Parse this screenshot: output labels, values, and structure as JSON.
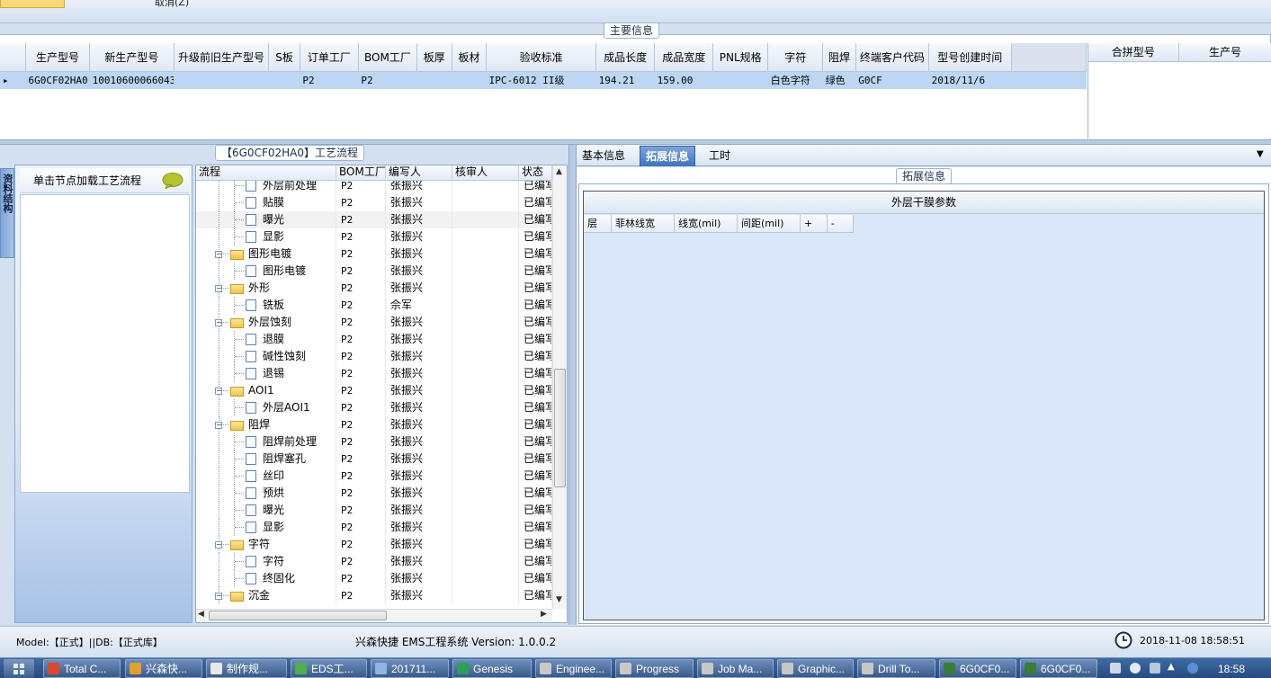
{
  "top": {
    "cancel_label": "取消(Z)"
  },
  "main_info": {
    "title": "主要信息",
    "columns": [
      "",
      "生产型号",
      "新生产型号",
      "升级前旧生产型号",
      "S板",
      "订单工厂",
      "BOM工厂",
      "板厚",
      "板材",
      "验收标准",
      "成品长度",
      "成品宽度",
      "PNL规格",
      "字符",
      "阻焊",
      "终端客户代码",
      "型号创建时间",
      ""
    ],
    "rows": [
      [
        "▸",
        "6G0CF02HA0",
        "10010600066043",
        "",
        "",
        "P2",
        "P2",
        "",
        "",
        "IPC-6012 II级",
        "194.21",
        "159.00",
        "",
        "白色字符",
        "绿色",
        "G0CF",
        "2018/11/6",
        ""
      ]
    ],
    "merge_columns": [
      "合拼型号",
      "生产号"
    ]
  },
  "left_panel": {
    "vertical_tab": "资料结构",
    "card_text": "单击节点加载工艺流程"
  },
  "flow": {
    "title": "【6G0CF02HA0】工艺流程",
    "columns": [
      "流程",
      "BOM工厂",
      "编写人",
      "核审人",
      "状态"
    ],
    "rows": [
      {
        "name": "外层前处理",
        "level": 2,
        "type": "doc",
        "bom": "P2",
        "writer": "张振兴",
        "reviewer": "",
        "status": "已编写"
      },
      {
        "name": "贴膜",
        "level": 2,
        "type": "doc",
        "bom": "P2",
        "writer": "张振兴",
        "reviewer": "",
        "status": "已编写"
      },
      {
        "name": "曝光",
        "level": 2,
        "type": "doc",
        "bom": "P2",
        "writer": "张振兴",
        "reviewer": "",
        "status": "已编写",
        "highlight": true
      },
      {
        "name": "显影",
        "level": 2,
        "type": "doc",
        "bom": "P2",
        "writer": "张振兴",
        "reviewer": "",
        "status": "已编写"
      },
      {
        "name": "图形电镀",
        "level": 1,
        "type": "folder",
        "bom": "P2",
        "writer": "张振兴",
        "reviewer": "",
        "status": "已编写"
      },
      {
        "name": "图形电镀",
        "level": 2,
        "type": "doc",
        "bom": "P2",
        "writer": "张振兴",
        "reviewer": "",
        "status": "已编写"
      },
      {
        "name": "外形",
        "level": 1,
        "type": "folder",
        "bom": "P2",
        "writer": "张振兴",
        "reviewer": "",
        "status": "已编写"
      },
      {
        "name": "铣板",
        "level": 2,
        "type": "doc",
        "bom": "P2",
        "writer": "佘军",
        "reviewer": "",
        "status": "已编写"
      },
      {
        "name": "外层蚀刻",
        "level": 1,
        "type": "folder",
        "bom": "P2",
        "writer": "张振兴",
        "reviewer": "",
        "status": "已编写"
      },
      {
        "name": "退膜",
        "level": 2,
        "type": "doc",
        "bom": "P2",
        "writer": "张振兴",
        "reviewer": "",
        "status": "已编写"
      },
      {
        "name": "碱性蚀刻",
        "level": 2,
        "type": "doc",
        "bom": "P2",
        "writer": "张振兴",
        "reviewer": "",
        "status": "已编写"
      },
      {
        "name": "退锡",
        "level": 2,
        "type": "doc",
        "bom": "P2",
        "writer": "张振兴",
        "reviewer": "",
        "status": "已编写"
      },
      {
        "name": "AOI1",
        "level": 1,
        "type": "folder",
        "bom": "P2",
        "writer": "张振兴",
        "reviewer": "",
        "status": "已编写"
      },
      {
        "name": "外层AOI1",
        "level": 2,
        "type": "doc",
        "bom": "P2",
        "writer": "张振兴",
        "reviewer": "",
        "status": "已编写"
      },
      {
        "name": "阻焊",
        "level": 1,
        "type": "folder",
        "bom": "P2",
        "writer": "张振兴",
        "reviewer": "",
        "status": "已编写"
      },
      {
        "name": "阻焊前处理",
        "level": 2,
        "type": "doc",
        "bom": "P2",
        "writer": "张振兴",
        "reviewer": "",
        "status": "已编写"
      },
      {
        "name": "阻焊塞孔",
        "level": 2,
        "type": "doc",
        "bom": "P2",
        "writer": "张振兴",
        "reviewer": "",
        "status": "已编写"
      },
      {
        "name": "丝印",
        "level": 2,
        "type": "doc",
        "bom": "P2",
        "writer": "张振兴",
        "reviewer": "",
        "status": "已编写"
      },
      {
        "name": "预烘",
        "level": 2,
        "type": "doc",
        "bom": "P2",
        "writer": "张振兴",
        "reviewer": "",
        "status": "已编写"
      },
      {
        "name": "曝光",
        "level": 2,
        "type": "doc",
        "bom": "P2",
        "writer": "张振兴",
        "reviewer": "",
        "status": "已编写"
      },
      {
        "name": "显影",
        "level": 2,
        "type": "doc",
        "bom": "P2",
        "writer": "张振兴",
        "reviewer": "",
        "status": "已编写"
      },
      {
        "name": "字符",
        "level": 1,
        "type": "folder",
        "bom": "P2",
        "writer": "张振兴",
        "reviewer": "",
        "status": "已编写"
      },
      {
        "name": "字符",
        "level": 2,
        "type": "doc",
        "bom": "P2",
        "writer": "张振兴",
        "reviewer": "",
        "status": "已编写"
      },
      {
        "name": "终固化",
        "level": 2,
        "type": "doc",
        "bom": "P2",
        "writer": "张振兴",
        "reviewer": "",
        "status": "已编写"
      },
      {
        "name": "沉金",
        "level": 1,
        "type": "folder",
        "bom": "P2",
        "writer": "张振兴",
        "reviewer": "",
        "status": "已编写"
      }
    ]
  },
  "right_panel": {
    "tabs": [
      {
        "label": "基本信息",
        "active": false
      },
      {
        "label": "拓展信息",
        "active": true
      },
      {
        "label": "工时",
        "active": false
      }
    ],
    "ext_title": "拓展信息",
    "dry_film_title": "外层干膜参数",
    "dry_film_columns": [
      "层",
      "菲林线宽",
      "线宽(mil)",
      "间距(mil)",
      "+",
      "-"
    ]
  },
  "status_bar": {
    "left": "Model:【正式】||DB:【正式库】",
    "center": "兴森快捷 EMS工程系统 Version: 1.0.0.2",
    "datetime": "2018-11-08 18:58:51"
  },
  "taskbar": {
    "items": [
      {
        "label": "Total C...",
        "color": "#d94a2c"
      },
      {
        "label": "兴森快...",
        "color": "#e0a030"
      },
      {
        "label": "制作规...",
        "color": "#e8e8e8"
      },
      {
        "label": "EDS工...",
        "color": "#4caf50"
      },
      {
        "label": "201711...",
        "color": "#8fb4e0"
      },
      {
        "label": "Genesis",
        "color": "#2e9e5b"
      },
      {
        "label": "Enginee...",
        "color": "#c8c8c8"
      },
      {
        "label": "Progress",
        "color": "#c8c8c8"
      },
      {
        "label": "Job Ma...",
        "color": "#c8c8c8"
      },
      {
        "label": "Graphic...",
        "color": "#c8c8c8"
      },
      {
        "label": "Drill To...",
        "color": "#c8c8c8"
      },
      {
        "label": "6G0CF0...",
        "color": "#3a7d3a"
      },
      {
        "label": "6G0CF0...",
        "color": "#3a7d3a"
      }
    ],
    "time": "18:58"
  }
}
